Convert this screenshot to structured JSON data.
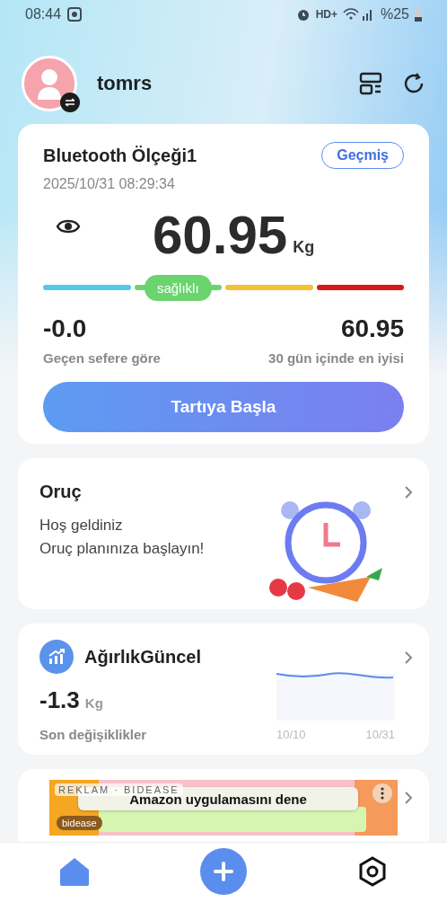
{
  "status_bar": {
    "time": "08:44",
    "network": "HD+",
    "battery": "%25"
  },
  "header": {
    "username": "tomrs"
  },
  "scale_card": {
    "device": "Bluetooth Ölçeği1",
    "history_button": "Geçmiş",
    "timestamp": "2025/10/31 08:29:34",
    "weight": "60.95",
    "unit": "Kg",
    "segments": [
      {
        "color": "#56c8e8",
        "selected": false
      },
      {
        "color": "#6cd46e",
        "selected": true,
        "label": "sağlıklı"
      },
      {
        "color": "#f2c230",
        "selected": false
      },
      {
        "color": "#d81818",
        "selected": false
      }
    ],
    "stats": [
      {
        "value": "-0.0",
        "label": "Geçen sefere göre"
      },
      {
        "value": "60.95",
        "label": "30 gün içinde en iyisi"
      }
    ],
    "start_button": "Tartıya Başla"
  },
  "fasting_card": {
    "title": "Oruç",
    "lines": [
      "Hoş geldiniz",
      "Oruç planınıza başlayın!"
    ]
  },
  "trend_card": {
    "title": "AğırlıkGüncel",
    "value": "-1.3",
    "unit": "Kg",
    "caption": "Son değişiklikler",
    "x_labels": [
      "10/10",
      "10/31"
    ]
  },
  "ad": {
    "label": "REKLAM · BIDEASE",
    "headline": "Amazon uygulamasını dene",
    "brand": "bidease"
  }
}
